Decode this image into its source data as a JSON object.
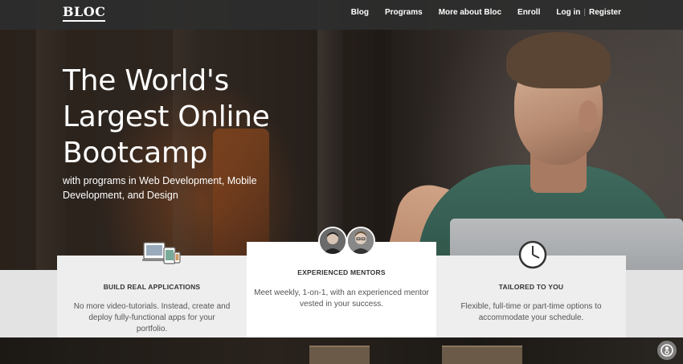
{
  "nav": {
    "logo": "BLOC",
    "links": [
      "Blog",
      "Programs",
      "More about Bloc",
      "Enroll",
      "Log in"
    ],
    "separator": "|",
    "register": "Register"
  },
  "hero": {
    "title_lines": [
      "The World's",
      "Largest Online",
      "Bootcamp"
    ],
    "subtitle": "with programs in Web Development, Mobile Development, and Design"
  },
  "features": [
    {
      "title": "BUILD REAL APPLICATIONS",
      "text": "No more video-tutorials. Instead, create and deploy fully-functional apps for your portfolio.",
      "icon": "devices-icon"
    },
    {
      "title": "EXPERIENCED MENTORS",
      "text": "Meet weekly, 1-on-1, with an experienced mentor vested in your success.",
      "icon": "mentor-avatars"
    },
    {
      "title": "TAILORED TO YOU",
      "text": "Flexible, full-time or part-time options to accommodate your schedule.",
      "icon": "clock-icon"
    }
  ],
  "colors": {
    "navbar": "#2e2e2e",
    "strip": "#e3e3e3",
    "card": "#eeeeee",
    "card_highlight": "#ffffff",
    "text_dark": "#333333"
  }
}
